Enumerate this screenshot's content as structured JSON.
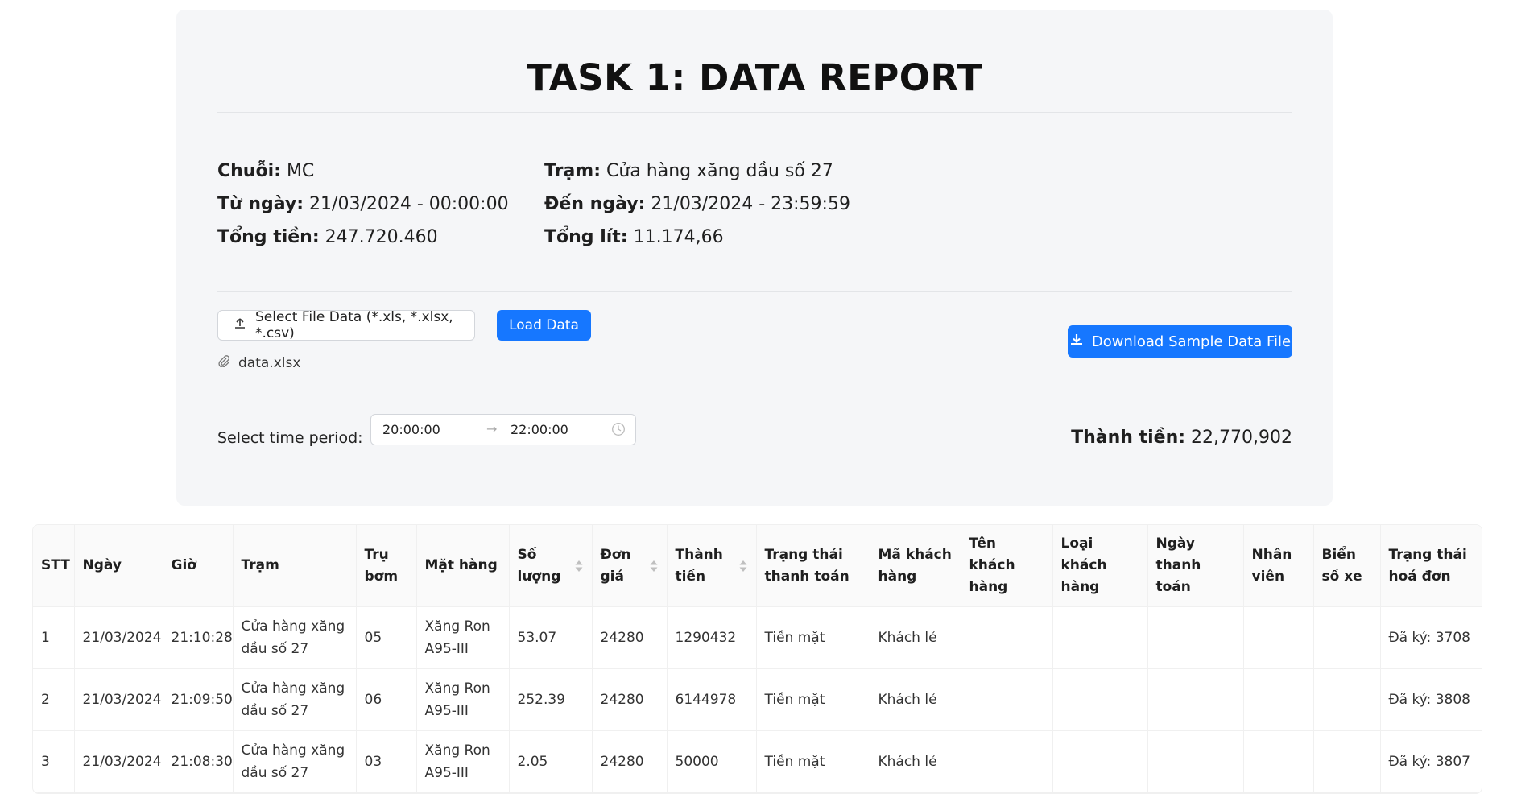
{
  "report": {
    "title": "TASK 1: DATA REPORT",
    "info": {
      "chain_label": "Chuỗi:",
      "chain_value": "MC",
      "station_label": "Trạm:",
      "station_value": "Cửa hàng xăng dầu số 27",
      "from_label": "Từ ngày:",
      "from_value": "21/03/2024 - 00:00:00",
      "to_label": "Đến ngày:",
      "to_value": "21/03/2024 - 23:59:59",
      "total_money_label": "Tổng tiền:",
      "total_money_value": "247.720.460",
      "total_liters_label": "Tổng lít:",
      "total_liters_value": "11.174,66"
    },
    "upload": {
      "select_label": "Select File Data (*.xls, *.xlsx, *.csv)",
      "load_label": "Load Data",
      "file_name": "data.xlsx",
      "download_label": "Download Sample Data File"
    },
    "period": {
      "label": "Select time period:",
      "start": "20:00:00",
      "end": "22:00:00",
      "arrow": "→",
      "amount_label": "Thành tiền:",
      "amount_value": "22,770,902"
    }
  },
  "table": {
    "headers": [
      "STT",
      "Ngày",
      "Giờ",
      "Trạm",
      "Trụ bơm",
      "Mặt hàng",
      "Số lượng",
      "Đơn giá",
      "Thành tiền",
      "Trạng thái thanh toán",
      "Mã khách hàng",
      "Tên khách hàng",
      "Loại khách hàng",
      "Ngày thanh toán",
      "Nhân viên",
      "Biển số xe",
      "Trạng thái hoá đơn"
    ],
    "rows": [
      [
        "1",
        "21/03/2024",
        "21:10:28",
        "Cửa hàng xăng dầu số 27",
        "05",
        "Xăng Ron A95-III",
        "53.07",
        "24280",
        "1290432",
        "Tiền mặt",
        "Khách lẻ",
        "",
        "",
        "",
        "",
        "",
        "Đã ký: 3708"
      ],
      [
        "2",
        "21/03/2024",
        "21:09:50",
        "Cửa hàng xăng dầu số 27",
        "06",
        "Xăng Ron A95-III",
        "252.39",
        "24280",
        "6144978",
        "Tiền mặt",
        "Khách lẻ",
        "",
        "",
        "",
        "",
        "",
        "Đã ký: 3808"
      ],
      [
        "3",
        "21/03/2024",
        "21:08:30",
        "Cửa hàng xăng dầu số 27",
        "03",
        "Xăng Ron A95-III",
        "2.05",
        "24280",
        "50000",
        "Tiền mặt",
        "Khách lẻ",
        "",
        "",
        "",
        "",
        "",
        "Đã ký: 3807"
      ]
    ]
  },
  "icons": {
    "upload": "upload-icon",
    "paperclip": "paperclip-icon",
    "download": "download-icon",
    "clock": "clock-icon",
    "sort": "sort-icon"
  },
  "colors": {
    "primary": "#1677ff",
    "panel": "#f5f6f8"
  }
}
